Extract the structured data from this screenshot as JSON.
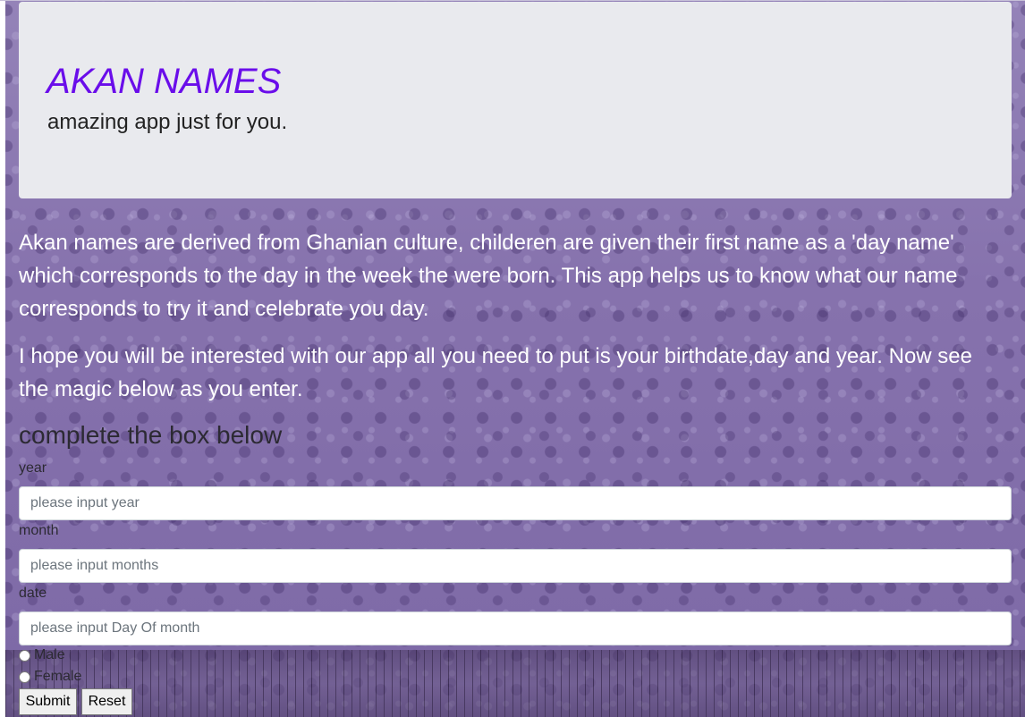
{
  "header": {
    "title": "AKAN NAMES",
    "subtitle": "amazing app just for you."
  },
  "intro": {
    "paragraph_1": "Akan names are derived from Ghanian culture, childeren are given their first name as a 'day name' which corresponds to the day in the week the were born. This app helps us to know what our name corresponds to try it and celebrate you day.",
    "paragraph_2": "I hope you will be interested with our app all you need to put is your birthdate,day and year. Now see the magic below as you enter."
  },
  "form": {
    "heading": "complete the box below",
    "year": {
      "label": "year",
      "placeholder": "please input year",
      "value": ""
    },
    "month": {
      "label": "month",
      "placeholder": "please input months",
      "value": ""
    },
    "date": {
      "label": "date",
      "placeholder": "please input Day Of month",
      "value": ""
    },
    "gender": {
      "options": [
        "Male",
        "Female"
      ],
      "selected": null
    },
    "submit_label": "Submit",
    "reset_label": "Reset"
  },
  "colors": {
    "title": "#6a0dea",
    "jumbotron_bg": "#e9eaee",
    "page_bg": "#8a76ad"
  }
}
